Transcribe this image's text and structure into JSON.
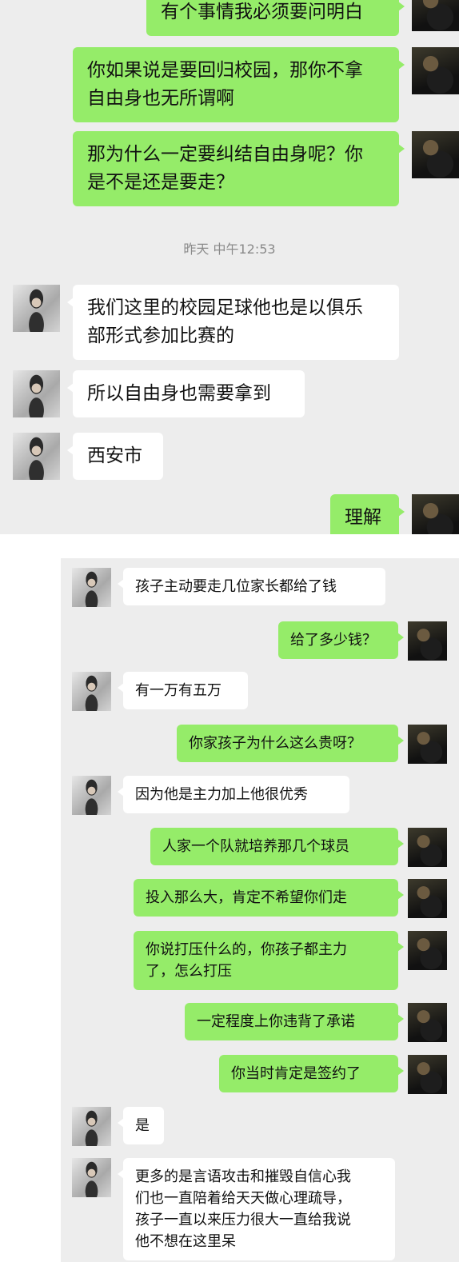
{
  "panel1": {
    "timestamp": "昨天 中午12:53",
    "messages": [
      {
        "sender": "self",
        "text": "有个事情我必须要问明白"
      },
      {
        "sender": "self",
        "text": "你如果说是要回归校园，那你不拿\n自由身也无所谓啊"
      },
      {
        "sender": "self",
        "text": "那为什么一定要纠结自由身呢？你\n是不是还是要走？"
      },
      {
        "sender": "other",
        "text": "我们这里的校园足球他也是以俱乐\n部形式参加比赛的"
      },
      {
        "sender": "other",
        "text": "所以自由身也需要拿到"
      },
      {
        "sender": "other",
        "text": "西安市"
      },
      {
        "sender": "self",
        "text": "理解"
      }
    ]
  },
  "panel2": {
    "messages": [
      {
        "sender": "other",
        "text": "孩子主动要走几位家长都给了钱"
      },
      {
        "sender": "self",
        "text": "给了多少钱？"
      },
      {
        "sender": "other",
        "text": "有一万有五万"
      },
      {
        "sender": "self",
        "text": "你家孩子为什么这么贵呀？"
      },
      {
        "sender": "other",
        "text": "因为他是主力加上他很优秀"
      },
      {
        "sender": "self",
        "text": "人家一个队就培养那几个球员"
      },
      {
        "sender": "self",
        "text": "投入那么大，肯定不希望你们走"
      },
      {
        "sender": "self",
        "text": "你说打压什么的，你孩子都主力\n了，怎么打压"
      },
      {
        "sender": "self",
        "text": "一定程度上你违背了承诺"
      },
      {
        "sender": "self",
        "text": "你当时肯定是签约了"
      },
      {
        "sender": "other",
        "text": "是"
      },
      {
        "sender": "other",
        "text": "更多的是言语攻击和摧毁自信心我\n们也一直陪着给天天做心理疏导，\n孩子一直以来压力很大一直给我说\n他不想在这里呆"
      }
    ]
  },
  "colors": {
    "sent_bubble": "#95ec69",
    "received_bubble": "#ffffff",
    "chat_background": "#ededed",
    "timestamp_text": "#8a8a8a"
  }
}
